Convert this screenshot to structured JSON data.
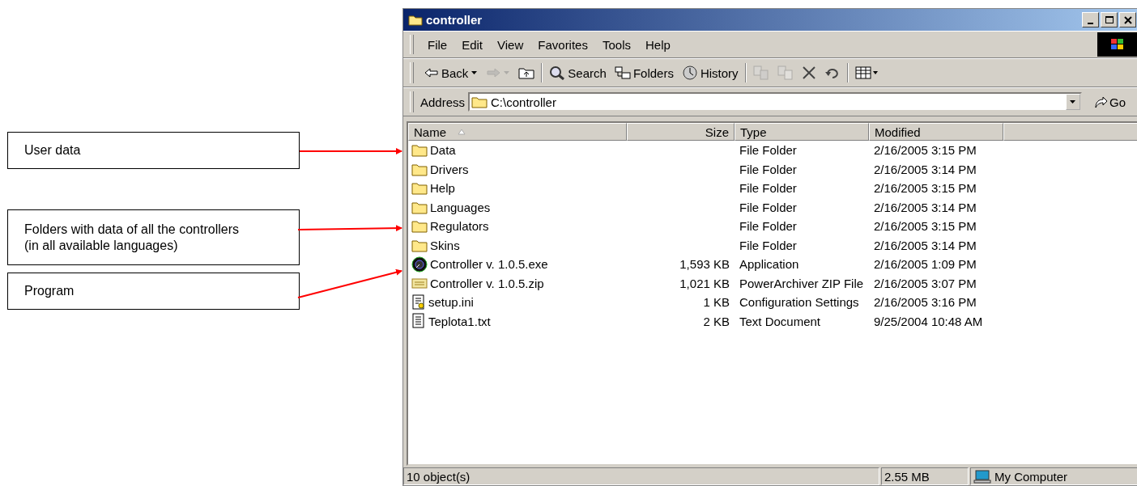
{
  "callouts": [
    {
      "text": "User data"
    },
    {
      "text": "Folders with data of all the controllers\n(in all available languages)"
    },
    {
      "text": "Program"
    }
  ],
  "window": {
    "title": "controller"
  },
  "menu": [
    "File",
    "Edit",
    "View",
    "Favorites",
    "Tools",
    "Help"
  ],
  "toolbar": [
    {
      "kind": "back",
      "label": "Back",
      "disabled": false
    },
    {
      "kind": "forward",
      "disabled": true
    },
    {
      "kind": "up",
      "disabled": false
    },
    {
      "kind": "search",
      "label": "Search",
      "disabled": false
    },
    {
      "kind": "folders",
      "label": "Folders",
      "disabled": false
    },
    {
      "kind": "history",
      "label": "History",
      "disabled": false
    },
    {
      "kind": "move",
      "disabled": true
    },
    {
      "kind": "copy",
      "disabled": true
    },
    {
      "kind": "delete",
      "disabled": false
    },
    {
      "kind": "undo",
      "disabled": false
    },
    {
      "kind": "views",
      "disabled": false
    }
  ],
  "address": {
    "label": "Address",
    "value": "C:\\controller",
    "go": "Go"
  },
  "columns": [
    {
      "label": "Name",
      "sorted": true
    },
    {
      "label": "Size",
      "sorted": false
    },
    {
      "label": "Type",
      "sorted": false
    },
    {
      "label": "Modified",
      "sorted": false
    }
  ],
  "rows": [
    {
      "kind": "folder",
      "name": "Data",
      "size": "",
      "type": "File Folder",
      "modified": "2/16/2005 3:15 PM"
    },
    {
      "kind": "folder",
      "name": "Drivers",
      "type": "File Folder",
      "modified": "2/16/2005 3:14 PM"
    },
    {
      "kind": "folder",
      "name": "Help",
      "type": "File Folder",
      "modified": "2/16/2005 3:15 PM"
    },
    {
      "kind": "folder",
      "name": "Languages",
      "type": "File Folder",
      "modified": "2/16/2005 3:14 PM"
    },
    {
      "kind": "folder",
      "name": "Regulators",
      "type": "File Folder",
      "modified": "2/16/2005 3:15 PM"
    },
    {
      "kind": "folder",
      "name": "Skins",
      "type": "File Folder",
      "modified": "2/16/2005 3:14 PM"
    },
    {
      "kind": "exe",
      "name": "Controller v. 1.0.5.exe",
      "size": "1,593 KB",
      "type": "Application",
      "modified": "2/16/2005 1:09 PM"
    },
    {
      "kind": "zip",
      "name": "Controller v. 1.0.5.zip",
      "size": "1,021 KB",
      "type": "PowerArchiver ZIP File",
      "modified": "2/16/2005 3:07 PM"
    },
    {
      "kind": "ini",
      "name": "setup.ini",
      "size": "1 KB",
      "type": "Configuration Settings",
      "modified": "2/16/2005 3:16 PM"
    },
    {
      "kind": "txt",
      "name": "Teplota1.txt",
      "size": "2 KB",
      "type": "Text Document",
      "modified": "9/25/2004 10:48 AM"
    }
  ],
  "status_bar": {
    "objects": "10 object(s)",
    "size": "2.55 MB",
    "zone": "My Computer"
  }
}
